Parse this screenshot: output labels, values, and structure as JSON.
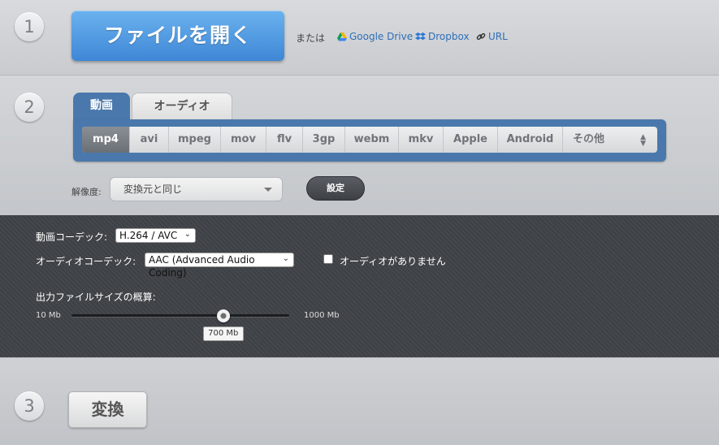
{
  "steps": {
    "one": "1",
    "two": "2",
    "three": "3"
  },
  "open": {
    "button_label": "ファイルを開く",
    "or_text": "または"
  },
  "sources": [
    {
      "label": "Google Drive",
      "icon": "google-drive-icon"
    },
    {
      "label": "Dropbox",
      "icon": "dropbox-icon"
    },
    {
      "label": "URL",
      "icon": "link-icon"
    }
  ],
  "tabs": {
    "video": "動画",
    "audio": "オーディオ",
    "active": "video"
  },
  "formats": {
    "items": [
      "mp4",
      "avi",
      "mpeg",
      "mov",
      "flv",
      "3gp",
      "webm",
      "mkv",
      "Apple",
      "Android",
      "その他"
    ],
    "selected": "mp4"
  },
  "resolution": {
    "label": "解像度:",
    "value": "変換元と同じ",
    "settings_label": "設定"
  },
  "advanced": {
    "video_codec_label": "動画コーデック:",
    "video_codec_value": "H.264 / AVC",
    "audio_codec_label": "オーディオコーデック:",
    "audio_codec_value": "AAC (Advanced Audio Coding)",
    "no_audio_label": "オーディオがありません",
    "no_audio_checked": false,
    "size_label": "出力ファイルサイズの概算:",
    "size_min_label": "10 Mb",
    "size_max_label": "1000 Mb",
    "size_value_label": "700 Mb",
    "size_min": 10,
    "size_max": 1000,
    "size_value": 700
  },
  "convert": {
    "button_label": "変換"
  },
  "colors": {
    "accent_blue": "#4a78ac",
    "open_button": "#4f9be3",
    "link": "#2f6fb8",
    "dark_panel": "#3f4246"
  }
}
